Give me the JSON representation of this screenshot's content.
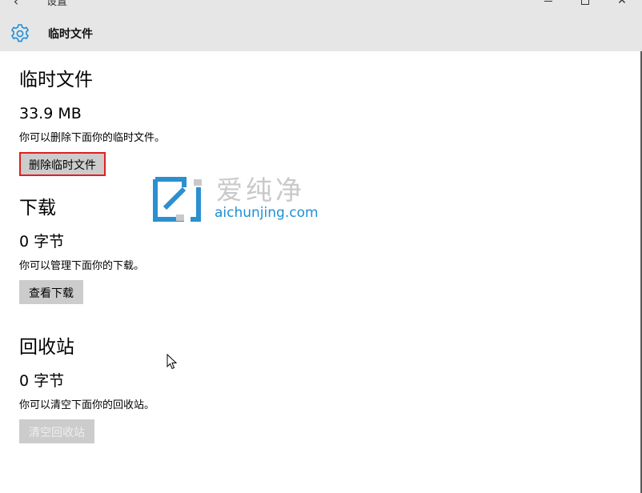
{
  "window": {
    "title": "设置",
    "back_glyph": "‹",
    "close_glyph": "✕"
  },
  "header": {
    "icon": "gear-icon",
    "title": "临时文件"
  },
  "sections": [
    {
      "title": "临时文件",
      "size": "33.9 MB",
      "description": "你可以删除下面你的临时文件。",
      "button_label": "删除临时文件",
      "button_state": "focused"
    },
    {
      "title": "下载",
      "size": "0 字节",
      "description": "你可以管理下面你的下载。",
      "button_label": "查看下载",
      "button_state": "normal"
    },
    {
      "title": "回收站",
      "size": "0 字节",
      "description": "你可以清空下面你的回收站。",
      "button_label": "清空回收站",
      "button_state": "disabled"
    }
  ],
  "watermark": {
    "text_cn": "爱纯净",
    "text_en": "aichunjing.com"
  },
  "colors": {
    "accent": "#1e8fd6",
    "focus_border": "#e02020",
    "button_bg": "#cccccc",
    "header_bg": "#e6e6e6"
  }
}
